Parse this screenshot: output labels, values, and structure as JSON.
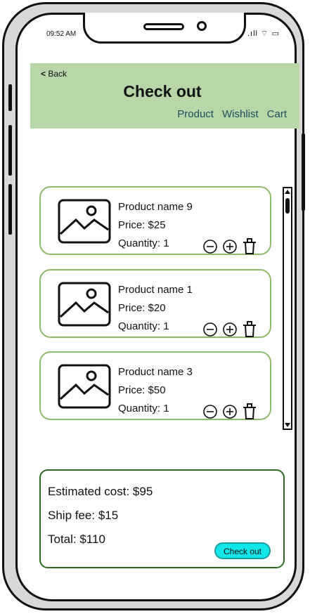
{
  "status_bar": {
    "time": "09:52 AM",
    "icons": ".ıll ⌔ ▭"
  },
  "header": {
    "back_label": "Back",
    "title": "Check out",
    "nav": [
      "Product",
      "Wishlist",
      "Cart"
    ]
  },
  "products": [
    {
      "name": "Product name 9",
      "price": "Price: $25",
      "quantity": "Quantity: 1"
    },
    {
      "name": "Product name 1",
      "price": "Price: $20",
      "quantity": "Quantity: 1"
    },
    {
      "name": "Product name 3",
      "price": "Price: $50",
      "quantity": "Quantity: 1"
    }
  ],
  "summary": {
    "estimated": "Estimated cost: $95",
    "ship": "Ship fee: $15",
    "total": "Total: $110",
    "checkout_label": "Check out"
  },
  "colors": {
    "header_bg": "#b7d7a8",
    "nav_text": "#1f4e5f",
    "card_border": "#8fbc6b",
    "summary_border": "#2e6b22",
    "button_bg": "#11e6e8"
  }
}
